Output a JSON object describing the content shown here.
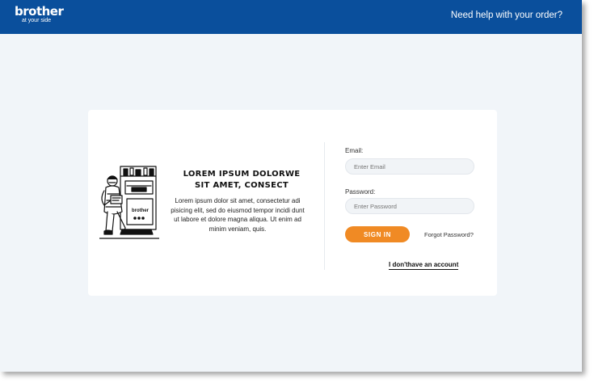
{
  "header": {
    "brand": "brother",
    "tagline": "at your side",
    "help_link": "Need help with your order?"
  },
  "promo": {
    "headline_line1": "LOREM IPSUM DOLORWE",
    "headline_line2": "SIT AMET, CONSECT",
    "body": "Lorem ipsum dolor sit amet, consectetur adi pisicing elit, sed do eiusmod tempor incidi dunt ut labore et dolore magna aliqua. Ut enim ad minim veniam, quis.",
    "printer_brand": "brother"
  },
  "form": {
    "email_label": "Email:",
    "email_placeholder": "Enter Email",
    "email_value": "",
    "password_label": "Password:",
    "password_placeholder": "Enter Password",
    "password_value": "",
    "signin_label": "SIGN IN",
    "forgot_label": "Forgot Password?",
    "no_account_label": "I don'thave an account"
  },
  "colors": {
    "header_bg": "#0a4f9c",
    "page_bg": "#f1f5f9",
    "accent": "#f08a24"
  }
}
